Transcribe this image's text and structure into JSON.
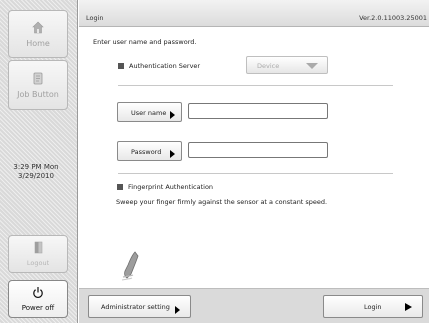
{
  "header": {
    "title": "Login",
    "version": "Ver.2.0.11003.25001"
  },
  "sidebar": {
    "home": {
      "label": "Home",
      "icon": "home-icon"
    },
    "job_button": {
      "label": "Job Button",
      "icon": "job-button-icon"
    },
    "clock": {
      "time": "3:29 PM  Mon",
      "date": "3/29/2010"
    },
    "logout": {
      "label": "Logout",
      "icon": "logout-icon"
    },
    "power_off": {
      "label": "Power off",
      "icon": "power-icon"
    }
  },
  "main": {
    "instruction": "Enter user name and password.",
    "auth_server": {
      "label": "Authentication Server",
      "selected": "Device"
    },
    "username": {
      "button_label": "User name",
      "value": ""
    },
    "password": {
      "button_label": "Password",
      "value": ""
    },
    "fingerprint": {
      "label": "Fingerprint Authentication",
      "instruction": "Sweep your finger firmly against the sensor at a constant speed.",
      "icon": "fingerprint-sensor-icon"
    }
  },
  "footer": {
    "admin_label": "Administrator setting",
    "login_label": "Login"
  },
  "colors": {
    "sidebar_bg": "#d9d9d9",
    "header_bg": "#e6e6e6",
    "footer_bg": "#dadada",
    "disabled_text": "#a0a0a0"
  }
}
